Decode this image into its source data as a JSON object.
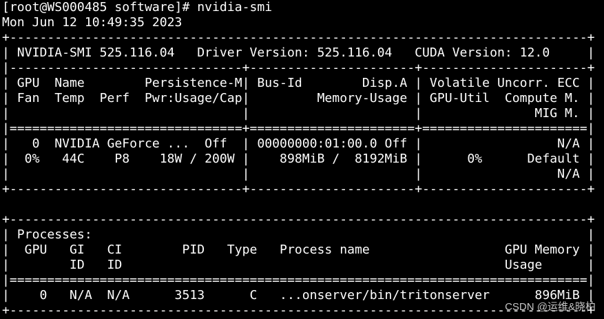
{
  "terminal": {
    "prompt": "[root@WS000485 software]# nvidia-smi",
    "datetime": "Mon Jun 12 10:49:35 2023"
  },
  "smi_output": [
    "+-----------------------------------------------------------------------------+",
    "| NVIDIA-SMI 525.116.04   Driver Version: 525.116.04   CUDA Version: 12.0     |",
    "|-------------------------------+----------------------+----------------------+",
    "| GPU  Name        Persistence-M| Bus-Id        Disp.A | Volatile Uncorr. ECC |",
    "| Fan  Temp  Perf  Pwr:Usage/Cap|         Memory-Usage | GPU-Util  Compute M. |",
    "|                               |                      |               MIG M. |",
    "|===============================+======================+======================|",
    "|   0  NVIDIA GeForce ...  Off  | 00000000:01:00.0 Off |                  N/A |",
    "|  0%   44C    P8    18W / 200W |    898MiB /  8192MiB |      0%      Default |",
    "|                               |                      |                  N/A |",
    "+-------------------------------+----------------------+----------------------+",
    "",
    "+-----------------------------------------------------------------------------+",
    "| Processes:                                                                  |",
    "|  GPU   GI   CI        PID   Type   Process name                  GPU Memory |",
    "|        ID   ID                                                   Usage      |",
    "|=============================================================================|",
    "|    0   N/A  N/A      3513      C   ...onserver/bin/tritonserver      896MiB |",
    "+-----------------------------------------------------------------------------+"
  ],
  "watermark": "CSDN @运维&晓柏"
}
